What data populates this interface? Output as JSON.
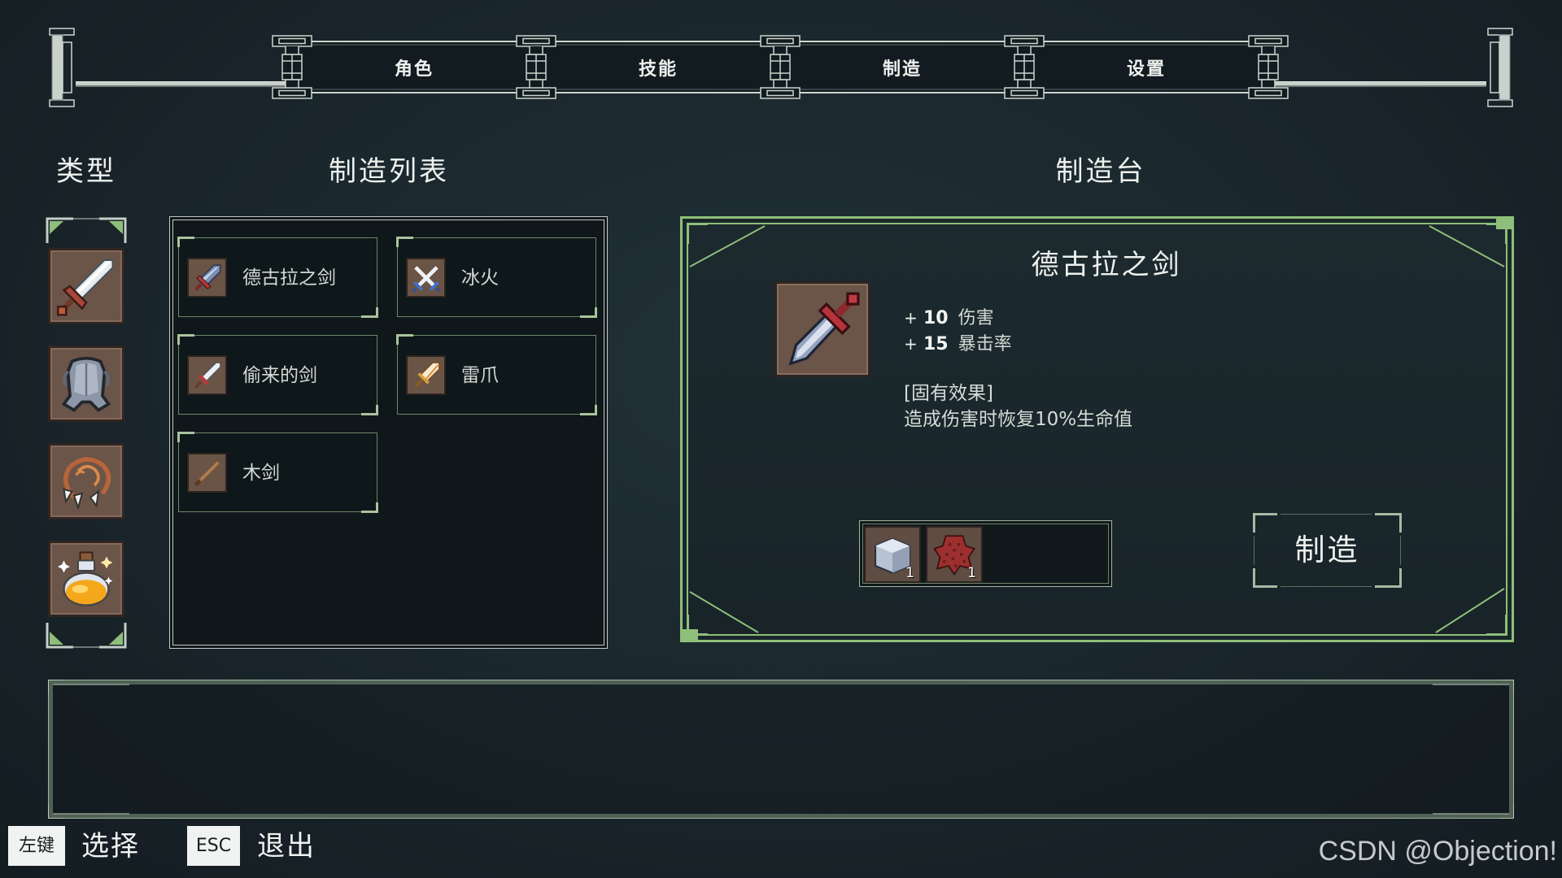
{
  "nav": {
    "tabs": [
      {
        "label": "角色"
      },
      {
        "label": "技能"
      },
      {
        "label": "制造"
      },
      {
        "label": "设置"
      }
    ]
  },
  "headers": {
    "types": "类型",
    "craft_list": "制造列表",
    "craft_station": "制造台"
  },
  "types": [
    {
      "icon": "sword-icon"
    },
    {
      "icon": "armor-icon"
    },
    {
      "icon": "necklace-icon"
    },
    {
      "icon": "potion-icon"
    }
  ],
  "recipes": [
    {
      "name": "德古拉之剑",
      "icon": "dracula-sword-icon"
    },
    {
      "name": "冰火",
      "icon": "crossed-swords-icon"
    },
    {
      "name": "偷来的剑",
      "icon": "stolen-sword-icon"
    },
    {
      "name": "雷爪",
      "icon": "thunder-claw-icon"
    },
    {
      "name": "木剑",
      "icon": "wooden-sword-icon"
    }
  ],
  "station": {
    "title": "德古拉之剑",
    "item_icon": "dracula-sword-icon",
    "stats": [
      {
        "sign": "+",
        "value": "10",
        "label": "伤害"
      },
      {
        "sign": "+",
        "value": "15",
        "label": "暴击率"
      }
    ],
    "effect_header": "[固有效果]",
    "effect_text": "造成伤害时恢复10%生命值",
    "materials": [
      {
        "icon": "stone-block-icon",
        "count": "1"
      },
      {
        "icon": "red-hide-icon",
        "count": "1"
      }
    ],
    "craft_button": "制造"
  },
  "hints": [
    {
      "key": "左键",
      "label": "选择"
    },
    {
      "key": "ESC",
      "label": "退出"
    }
  ],
  "watermark": "CSDN @Objection!",
  "colors": {
    "panel_border": "#c4cbc6",
    "station_border": "#8fbe7a",
    "item_border": "#6c8769",
    "item_tile": "#6b5548",
    "text": "#eef2ee"
  }
}
